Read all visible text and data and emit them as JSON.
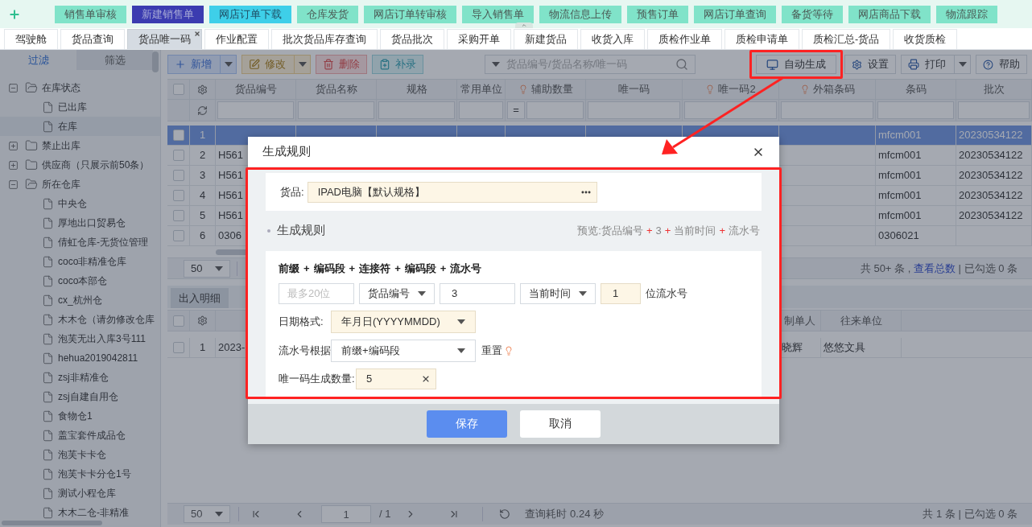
{
  "top_nav": {
    "items": [
      {
        "label": "销售单审核",
        "selected": false,
        "hover": false
      },
      {
        "label": "新建销售单",
        "selected": true,
        "hover": false
      },
      {
        "label": "网店订单下载",
        "selected": false,
        "hover": true
      },
      {
        "label": "仓库发货",
        "selected": false,
        "hover": false
      },
      {
        "label": "网店订单转审核",
        "selected": false,
        "hover": false
      },
      {
        "label": "导入销售单",
        "selected": false,
        "hover": false
      },
      {
        "label": "物流信息上传",
        "selected": false,
        "hover": false
      },
      {
        "label": "预售订单",
        "selected": false,
        "hover": false
      },
      {
        "label": "网店订单查询",
        "selected": false,
        "hover": false
      },
      {
        "label": "备货等待",
        "selected": false,
        "hover": false
      },
      {
        "label": "网店商品下载",
        "selected": false,
        "hover": false
      },
      {
        "label": "物流跟踪",
        "selected": false,
        "hover": false
      }
    ]
  },
  "tabs": [
    {
      "label": "驾驶舱",
      "selected": false
    },
    {
      "label": "货品查询",
      "selected": false
    },
    {
      "label": "货品唯一码",
      "selected": true
    },
    {
      "label": "作业配置",
      "selected": false
    },
    {
      "label": "批次货品库存查询",
      "selected": false
    },
    {
      "label": "货品批次",
      "selected": false
    },
    {
      "label": "采购开单",
      "selected": false
    },
    {
      "label": "新建货品",
      "selected": false
    },
    {
      "label": "收货入库",
      "selected": false
    },
    {
      "label": "质检作业单",
      "selected": false
    },
    {
      "label": "质检申请单",
      "selected": false
    },
    {
      "label": "质检汇总-货品",
      "selected": false
    },
    {
      "label": "收货质检",
      "selected": false
    }
  ],
  "sidebar": {
    "tabs": [
      {
        "label": "过滤",
        "selected": true
      },
      {
        "label": "筛选",
        "selected": false
      }
    ],
    "tree": [
      {
        "kind": "folder",
        "label": "在库状态",
        "expanded": true,
        "children": [
          {
            "kind": "leaf",
            "label": "已出库",
            "selected": false
          },
          {
            "kind": "leaf",
            "label": "在库",
            "selected": true
          }
        ]
      },
      {
        "kind": "folder",
        "label": "禁止出库",
        "expanded": false
      },
      {
        "kind": "folder",
        "label": "供应商（只展示前50条）",
        "expanded": false
      },
      {
        "kind": "folder",
        "label": "所在仓库",
        "expanded": true,
        "children": [
          {
            "kind": "leaf",
            "label": "中央仓",
            "selected": false
          },
          {
            "kind": "leaf",
            "label": "厚地出口贸易仓",
            "selected": false
          },
          {
            "kind": "leaf",
            "label": "倩虹仓库-无货位管理",
            "selected": false
          },
          {
            "kind": "leaf",
            "label": "coco非精准仓库",
            "selected": false
          },
          {
            "kind": "leaf",
            "label": "coco本部仓",
            "selected": false
          },
          {
            "kind": "leaf",
            "label": "cx_杭州仓",
            "selected": false
          },
          {
            "kind": "leaf",
            "label": "木木仓（请勿修改仓库",
            "selected": false
          },
          {
            "kind": "leaf",
            "label": "泡芙无出入库3号111",
            "selected": false
          },
          {
            "kind": "leaf",
            "label": "hehua2019042811",
            "selected": false
          },
          {
            "kind": "leaf",
            "label": "zsj非精准仓",
            "selected": false
          },
          {
            "kind": "leaf",
            "label": "zsj自建自用仓",
            "selected": false
          },
          {
            "kind": "leaf",
            "label": "食物仓1",
            "selected": false
          },
          {
            "kind": "leaf",
            "label": "盖宝套件成品仓",
            "selected": false
          },
          {
            "kind": "leaf",
            "label": "泡芙卡卡仓",
            "selected": false
          },
          {
            "kind": "leaf",
            "label": "泡芙卡卡分仓1号",
            "selected": false
          },
          {
            "kind": "leaf",
            "label": "测试小程仓库",
            "selected": false
          },
          {
            "kind": "leaf",
            "label": "木木二仓-非精准",
            "selected": false
          }
        ]
      }
    ]
  },
  "toolbar": {
    "buttons": [
      {
        "kind": "primary",
        "label": "新增",
        "dropdown": true
      },
      {
        "kind": "warning",
        "label": "修改",
        "dropdown": true
      },
      {
        "kind": "danger",
        "label": "删除",
        "dropdown": false
      },
      {
        "kind": "info",
        "label": "补录",
        "dropdown": false
      }
    ],
    "search": {
      "placeholder": "货品编号/货品名称/唯一码"
    },
    "right_buttons": [
      {
        "kind": "generate",
        "label": "自动生成",
        "dropdown": false,
        "annotated": true
      },
      {
        "kind": "settings",
        "label": "设置",
        "dropdown": false
      },
      {
        "kind": "print",
        "label": "打印",
        "dropdown": true
      },
      {
        "kind": "help",
        "label": "帮助",
        "dropdown": false
      }
    ]
  },
  "table": {
    "all_checked": false,
    "columns": [
      {
        "label": "货品编号",
        "hint": false
      },
      {
        "label": "货品名称",
        "hint": false
      },
      {
        "label": "规格",
        "hint": false
      },
      {
        "label": "常用单位",
        "hint": false
      },
      {
        "label": "辅助数量",
        "hint": true,
        "filter_prefix": "="
      },
      {
        "label": "唯一码",
        "hint": false
      },
      {
        "label": "唯一码2",
        "hint": true
      },
      {
        "label": "外箱条码",
        "hint": true
      },
      {
        "label": "条码",
        "hint": false
      },
      {
        "label": "批次",
        "hint": false
      }
    ],
    "rows": [
      {
        "index": "1",
        "selected": true,
        "checked": false,
        "barcode": "mfcm001",
        "batch": "20230534122"
      },
      {
        "index": "2",
        "selected": false,
        "checked": false,
        "code": "H561",
        "barcode": "mfcm001",
        "batch": "20230534122"
      },
      {
        "index": "3",
        "selected": false,
        "checked": false,
        "code": "H561",
        "barcode": "mfcm001",
        "batch": "20230534122"
      },
      {
        "index": "4",
        "selected": false,
        "checked": false,
        "code": "H561",
        "barcode": "mfcm001",
        "batch": "20230534122"
      },
      {
        "index": "5",
        "selected": false,
        "checked": false,
        "code": "H561",
        "barcode": "mfcm001",
        "batch": "20230534122"
      },
      {
        "index": "6",
        "selected": false,
        "checked": false,
        "code": "0306",
        "barcode": "0306021"
      }
    ],
    "pager": {
      "page_size": "50",
      "summary_prefix": "共 50+ 条 ,",
      "summary_link": "查看总数",
      "summary_suffix": "| 已勾选 0 条"
    }
  },
  "detail": {
    "tabs": [
      {
        "label": "出入明细",
        "selected": true
      }
    ],
    "all_checked": false,
    "columns": [
      {
        "label": "制单人"
      },
      {
        "label": "往来单位"
      }
    ],
    "rows": [
      {
        "index": "1",
        "checked": false,
        "date": "2023-",
        "creator": "晓辉",
        "partner": "悠悠文具"
      }
    ],
    "pager": {
      "page_size": "50",
      "page": "1",
      "total_pages": "/ 1",
      "timing": "查询耗时 0.24 秒",
      "summary": "共 1 条 | 已勾选 0 条"
    }
  },
  "dialog": {
    "title": "生成规则",
    "annotated": true,
    "goods": {
      "label": "货品:",
      "value": "IPAD电脑【默认规格】",
      "required": true
    },
    "section_title": "生成规则",
    "preview_label": "预览:",
    "preview_parts": [
      "货品编号",
      "3",
      "当前时间",
      "流水号"
    ],
    "separator": "+",
    "formula_parts": [
      "前缀",
      "编码段",
      "连接符",
      "编码段",
      "流水号"
    ],
    "prefix": {
      "placeholder": "最多20位"
    },
    "segment_1": "货品编号",
    "connector": "3",
    "segment_2": "当前时间",
    "serial_digits": {
      "value": "1",
      "required": true
    },
    "serial_suffix": "位流水号",
    "date_format": {
      "label": "日期格式:",
      "value": "年月日(YYYYMMDD)",
      "required": true
    },
    "serial_basis": {
      "label": "流水号根据",
      "value": "前缀+编码段",
      "required": false
    },
    "reset": "重置",
    "count": {
      "label": "唯一码生成数量:",
      "value": "5",
      "required": true
    },
    "buttons": [
      {
        "kind": "primary",
        "label": "保存"
      },
      {
        "kind": "default",
        "label": "取消"
      }
    ]
  }
}
